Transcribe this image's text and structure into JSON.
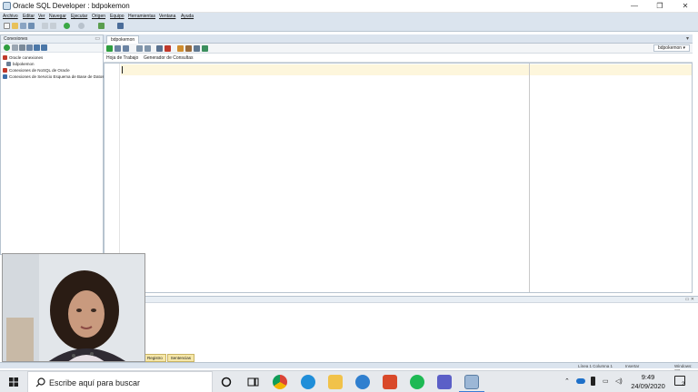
{
  "window": {
    "title": "Oracle SQL Developer : bdpokemon",
    "controls": [
      "—",
      "❐",
      "✕"
    ]
  },
  "menu": [
    "Archivo",
    "Editar",
    "Ver",
    "Navegar",
    "Ejecutar",
    "Origen",
    "Equipo",
    "Herramientas",
    "Ventana",
    "Ayuda"
  ],
  "connections": {
    "panel_title": "Conexiones",
    "tree": [
      "Oracle conexiones",
      "bdpokemon",
      "Conexiones de NoSQL de Oracle",
      "Conexiones de Servicio Esquema de Base de Datos"
    ]
  },
  "editor": {
    "tab_label": "bdpokemon",
    "connection_selector": "bdpokemon",
    "subtabs": [
      "Hoja de Trabajo",
      "Generador de Consultas"
    ]
  },
  "bottom_tabs": [
    "Registro",
    "Sentencias"
  ],
  "status": {
    "position": "Línea 1 Columna 1",
    "mode": "Insertar",
    "os": "Windows: CR"
  },
  "taskbar": {
    "search_placeholder": "Escribe aquí para buscar",
    "time": "9:49",
    "date": "24/09/2020",
    "notification_count": "2"
  },
  "colors": {
    "accent": "#dbe4ee",
    "current_line": "#fdf6dc",
    "tab_highlight": "#f6e7a8"
  }
}
